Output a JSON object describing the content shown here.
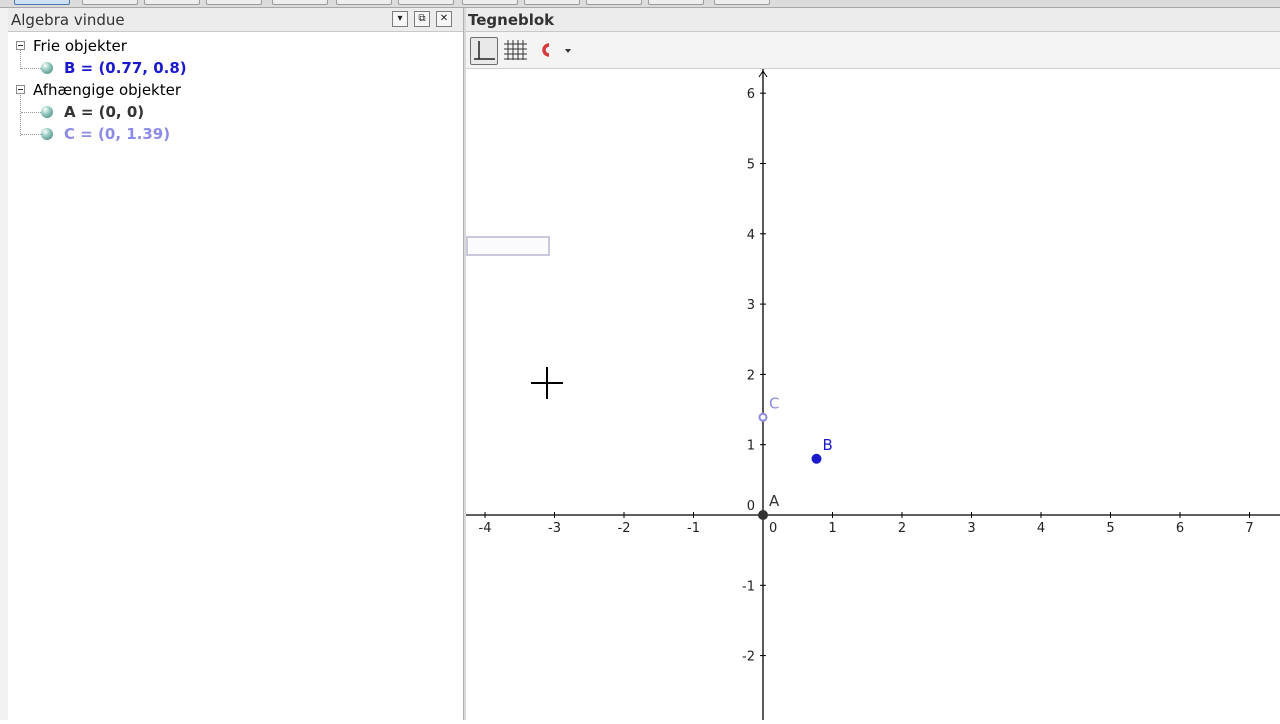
{
  "algebra": {
    "title": "Algebra vindue",
    "free_group": "Frie objekter",
    "dependent_group": "Afhængige objekter",
    "items": [
      {
        "label": "B = (0.77, 0.8)",
        "color": "#1a1acc"
      },
      {
        "label": "A = (0, 0)",
        "color": "#333333"
      },
      {
        "label": "C = (0, 1.39)",
        "color": "#8c8ce6"
      }
    ]
  },
  "graphics": {
    "title": "Tegneblok",
    "x_ticks": [
      "-4",
      "-3",
      "-2",
      "-1",
      "0",
      "1",
      "2",
      "3",
      "4",
      "5",
      "6",
      "7"
    ],
    "y_ticks": [
      "6",
      "5",
      "4",
      "3",
      "2",
      "1",
      "0",
      "-1",
      "-2"
    ],
    "points": [
      {
        "name": "A",
        "x": 0,
        "y": 0,
        "color": "#333333"
      },
      {
        "name": "B",
        "x": 0.77,
        "y": 0.8,
        "color": "#1a1acc"
      },
      {
        "name": "C",
        "x": 0,
        "y": 1.39,
        "color": "#8c8ce6"
      }
    ]
  }
}
